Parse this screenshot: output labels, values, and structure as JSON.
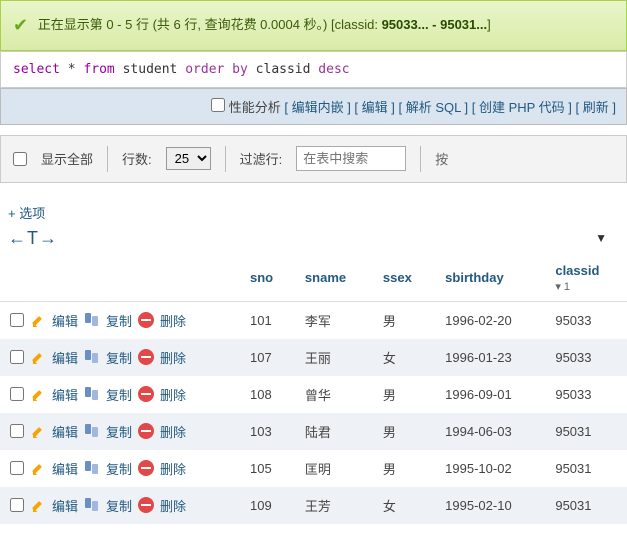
{
  "status": {
    "prefix": "正在显示第 0 - 5 行 (共 6 行, 查询花费 0.0004 秒。) [classid: ",
    "range": "95033... - 95031...",
    "suffix": "]"
  },
  "sql": {
    "select": "select",
    "star": "*",
    "from": "from",
    "table": "student",
    "order": "order by",
    "col": "classid",
    "dir": "desc"
  },
  "toolbar": {
    "perf": "性能分析",
    "inline": "编辑内嵌",
    "edit": "编辑",
    "explain": "解析 SQL",
    "php": "创建 PHP 代码",
    "refresh": "刷新"
  },
  "controls": {
    "showall": "显示全部",
    "rows_label": "行数:",
    "rows_value": "25",
    "filter_label": "过滤行:",
    "filter_placeholder": "在表中搜索",
    "btn_trunc": "按"
  },
  "options_link": "+ 选项",
  "arrows": "←T→",
  "headers": {
    "sno": "sno",
    "sname": "sname",
    "ssex": "ssex",
    "sbirthday": "sbirthday",
    "classid": "classid",
    "classid_sub": "▾ 1"
  },
  "actions": {
    "edit": "编辑",
    "copy": "复制",
    "delete": "删除"
  },
  "rows": [
    {
      "sno": "101",
      "sname": "李军",
      "ssex": "男",
      "sbirthday": "1996-02-20",
      "classid": "95033"
    },
    {
      "sno": "107",
      "sname": "王丽",
      "ssex": "女",
      "sbirthday": "1996-01-23",
      "classid": "95033"
    },
    {
      "sno": "108",
      "sname": "曾华",
      "ssex": "男",
      "sbirthday": "1996-09-01",
      "classid": "95033"
    },
    {
      "sno": "103",
      "sname": "陆君",
      "ssex": "男",
      "sbirthday": "1994-06-03",
      "classid": "95031"
    },
    {
      "sno": "105",
      "sname": "匡明",
      "ssex": "男",
      "sbirthday": "1995-10-02",
      "classid": "95031"
    },
    {
      "sno": "109",
      "sname": "王芳",
      "ssex": "女",
      "sbirthday": "1995-02-10",
      "classid": "95031"
    }
  ]
}
